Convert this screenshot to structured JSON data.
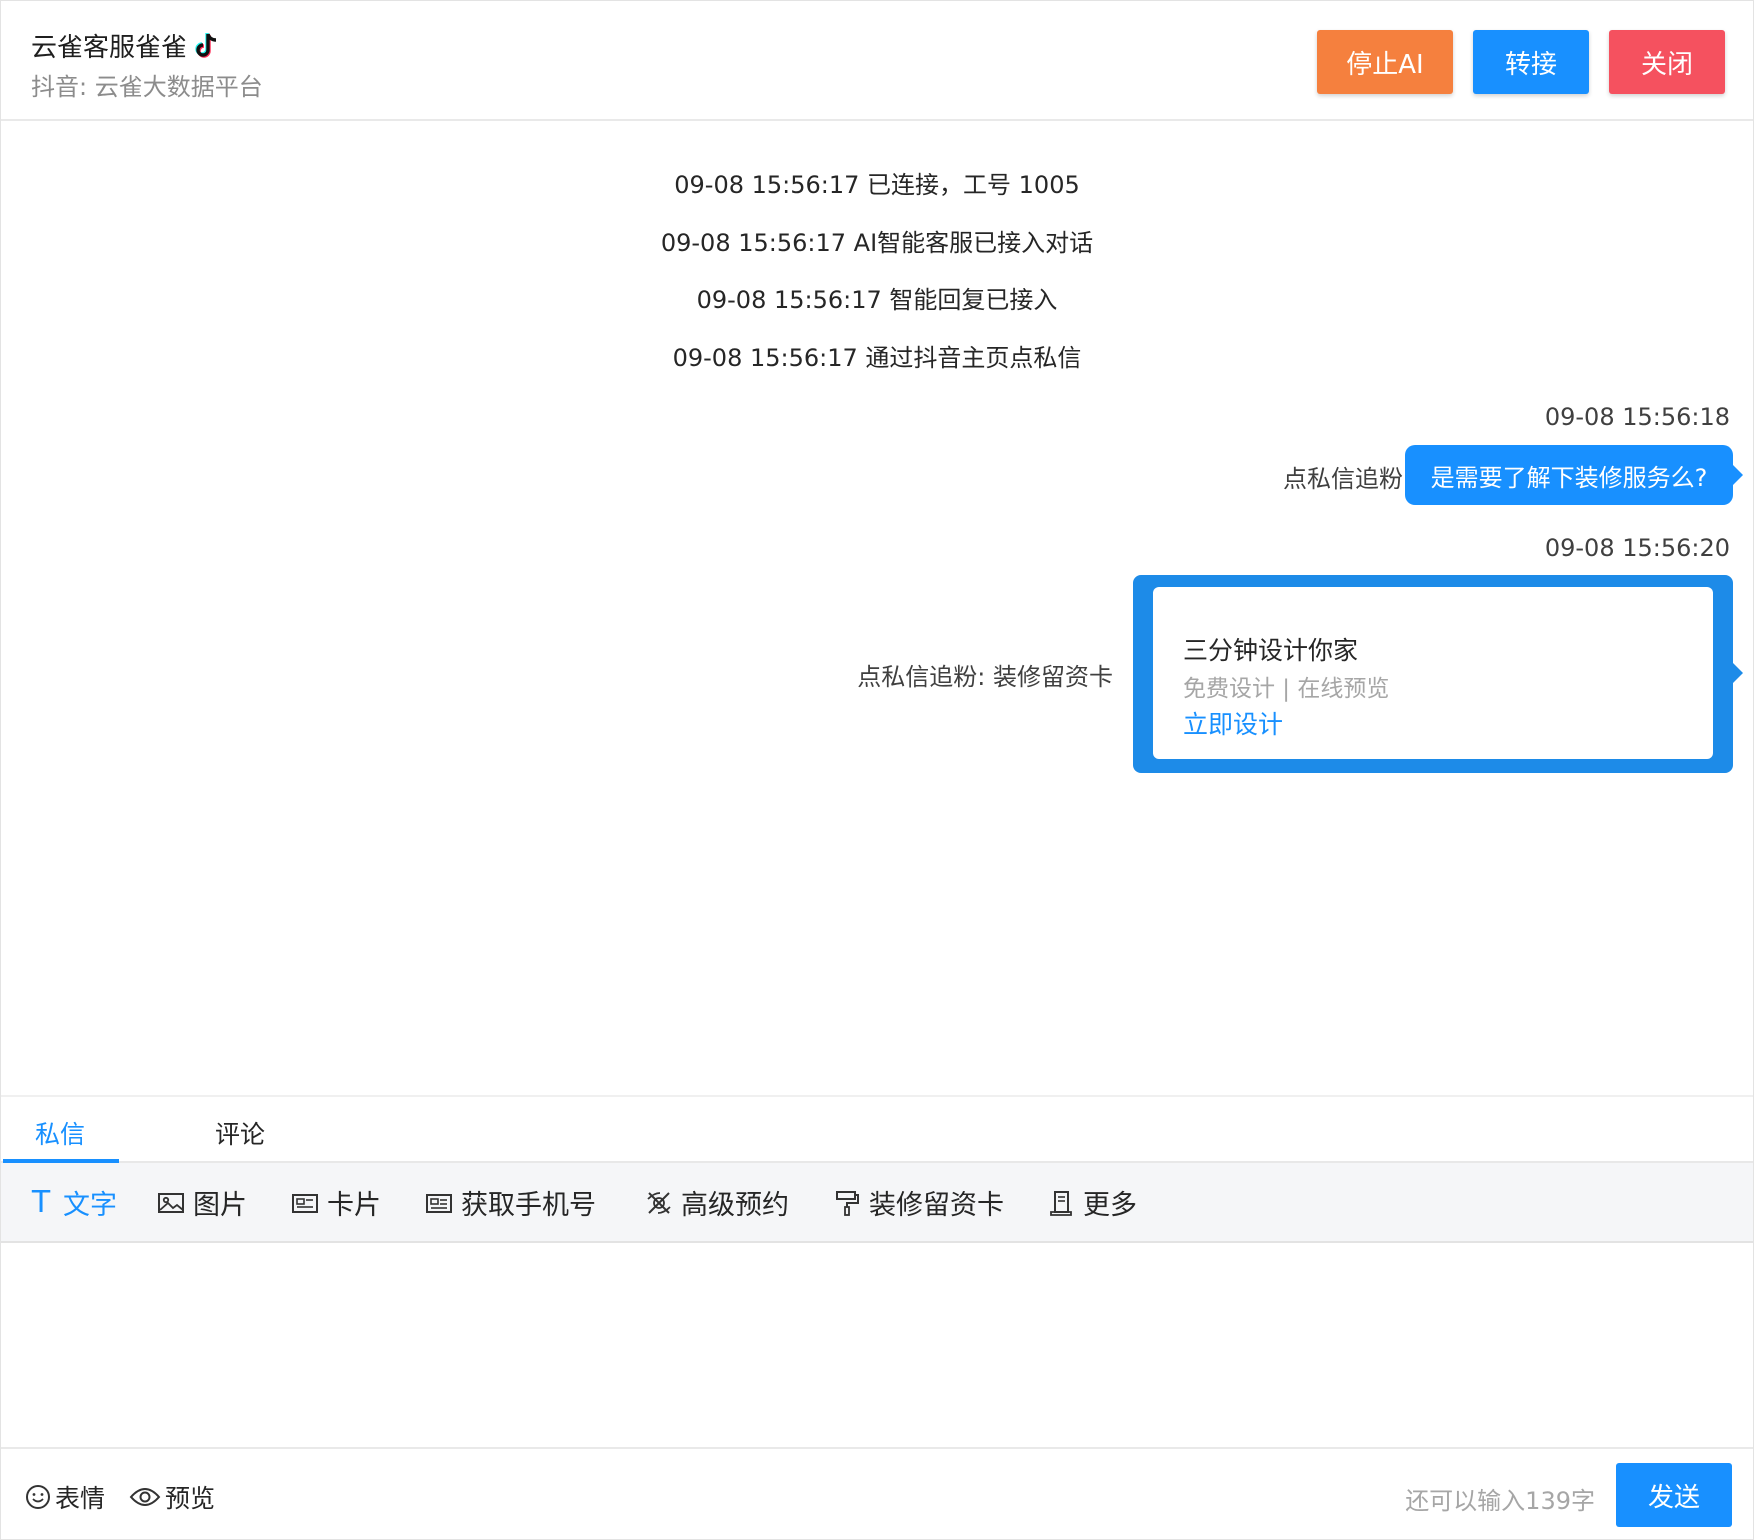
{
  "header": {
    "title": "云雀客服雀雀",
    "subtitle": "抖音: 云雀大数据平台",
    "buttons": {
      "stop_ai": "停止AI",
      "transfer": "转接",
      "close": "关闭"
    },
    "colors": {
      "stop_ai": "#f5803e",
      "transfer": "#1890ff",
      "close": "#f5515f"
    }
  },
  "system_messages": [
    "09-08 15:56:17 已连接，工号 1005",
    "09-08 15:56:17 AI智能客服已接入对话",
    "09-08 15:56:17 智能回复已接入",
    "09-08 15:56:17 通过抖音主页点私信"
  ],
  "messages": [
    {
      "timestamp": "09-08 15:56:18",
      "sender": "点私信追粉",
      "text": "是需要了解下装修服务么?"
    },
    {
      "timestamp": "09-08 15:56:20",
      "sender": "点私信追粉: 装修留资卡",
      "card": {
        "title": "三分钟设计你家",
        "subtitle": "免费设计 | 在线预览",
        "link": "立即设计"
      }
    }
  ],
  "tabs": [
    "私信",
    "评论"
  ],
  "toolbar": [
    "文字",
    "图片",
    "卡片",
    "获取手机号",
    "高级预约",
    "装修留资卡",
    "更多"
  ],
  "input": {
    "placeholder": "",
    "value": ""
  },
  "bottom": {
    "emoji": "表情",
    "preview": "预览",
    "counter": "还可以输入139字",
    "send": "发送"
  },
  "accent": "#1890ff"
}
